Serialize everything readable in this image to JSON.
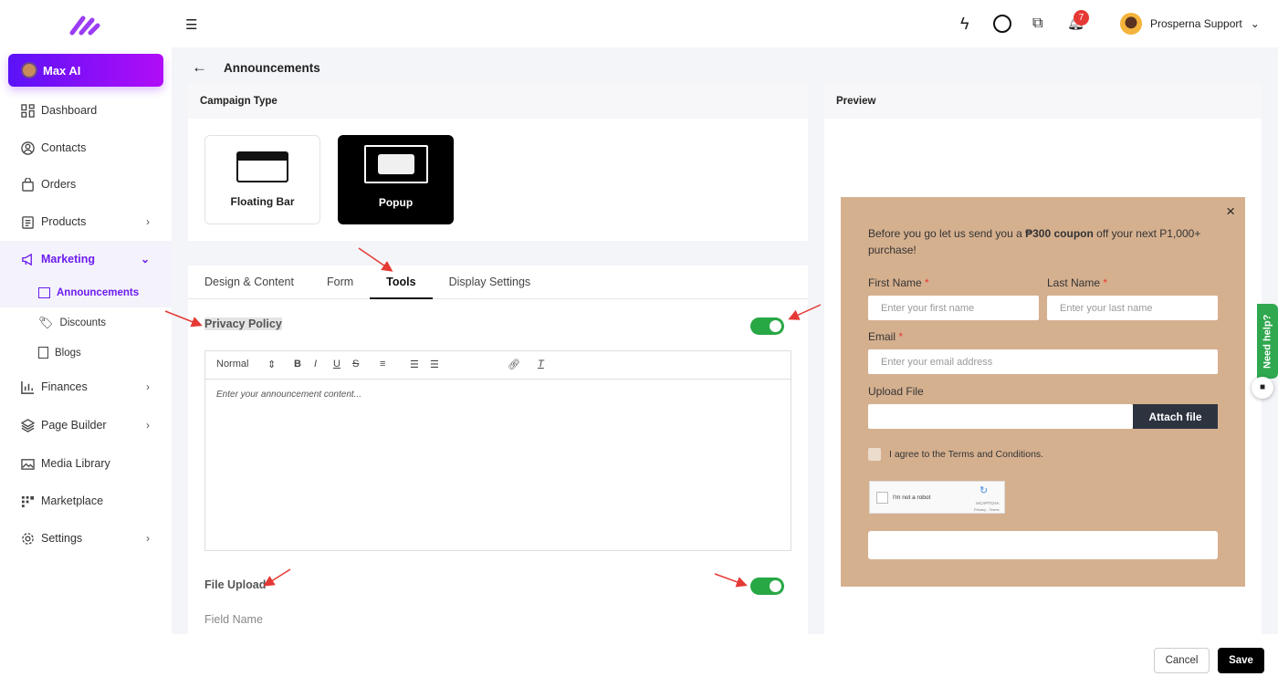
{
  "sidebar": {
    "max_ai": "Max AI",
    "items": [
      "Dashboard",
      "Contacts",
      "Orders",
      "Products",
      "Marketing",
      "Finances",
      "Page Builder",
      "Media Library",
      "Marketplace",
      "Settings"
    ],
    "sub_items": [
      "Announcements",
      "Discounts",
      "Blogs"
    ]
  },
  "topbar": {
    "notifications": "7",
    "user": "Prosperna Support"
  },
  "page": {
    "title": "Announcements"
  },
  "campaign": {
    "header": "Campaign Type",
    "options": [
      "Floating Bar",
      "Popup"
    ],
    "selected": "Popup"
  },
  "tabs": [
    "Design & Content",
    "Form",
    "Tools",
    "Display Settings"
  ],
  "tools": {
    "privacy_policy": "Privacy Policy",
    "privacy_enabled": true,
    "editor_format": "Normal",
    "editor_placeholder": "Enter your announcement content...",
    "file_upload": "File Upload",
    "file_upload_enabled": true,
    "field_name": "Field Name"
  },
  "preview": {
    "header": "Preview",
    "intro_pre": "Before you go let us send you a ",
    "intro_bold": "₱300 coupon",
    "intro_post": " off your next P1,000+ purchase!",
    "first_name": "First Name",
    "first_ph": "Enter your first name",
    "last_name": "Last Name",
    "last_ph": "Enter your last name",
    "email": "Email",
    "email_ph": "Enter your email address",
    "upload": "Upload File",
    "attach": "Attach file",
    "terms": "I agree to the Terms and Conditions.",
    "captcha": "I'm not a robot",
    "captcha_brand": "reCAPTCHA",
    "captcha_links": "Privacy - Terms",
    "required": "*",
    "bg_color": "#d5b08f"
  },
  "help": "Need help?",
  "footer": {
    "cancel": "Cancel",
    "save": "Save"
  }
}
